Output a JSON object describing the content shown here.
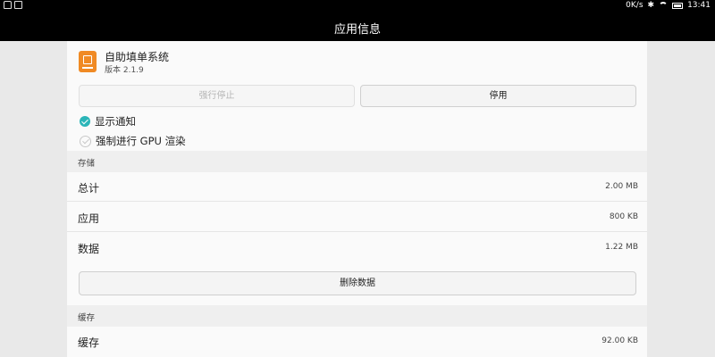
{
  "status_bar": {
    "speed": "0K/s",
    "time": "13:41",
    "icons": [
      "car-icon",
      "image-icon",
      "bluetooth-icon",
      "wifi-icon",
      "battery-icon"
    ]
  },
  "title_bar": {
    "title": "应用信息"
  },
  "app": {
    "name": "自助填单系统",
    "version": "版本 2.1.9",
    "icon_color": "#f08a24"
  },
  "buttons": {
    "force_stop": "强行停止",
    "disable": "停用",
    "clear_data": "删除数据"
  },
  "checkboxes": [
    {
      "label": "显示通知",
      "checked": true
    },
    {
      "label": "强制进行 GPU 渲染",
      "checked": false
    }
  ],
  "storage": {
    "header": "存储",
    "rows": [
      {
        "label": "总计",
        "value": "2.00 MB"
      },
      {
        "label": "应用",
        "value": "800 KB"
      },
      {
        "label": "数据",
        "value": "1.22 MB"
      }
    ]
  },
  "cache": {
    "header": "缓存",
    "rows": [
      {
        "label": "缓存",
        "value": "92.00 KB"
      }
    ]
  },
  "colors": {
    "accent": "#2bb5b8",
    "title_bg": "#000000"
  }
}
